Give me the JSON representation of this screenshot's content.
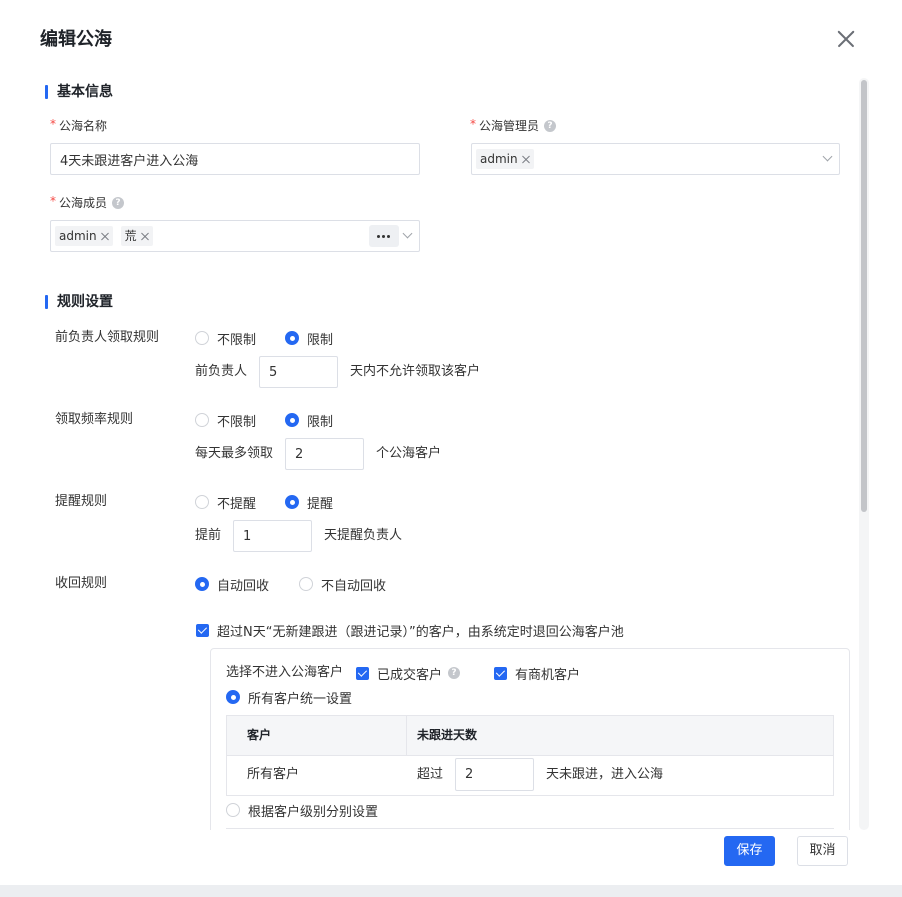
{
  "dialog": {
    "title": "编辑公海"
  },
  "basic": {
    "section_title": "基本信息",
    "required_mark": "*",
    "name": {
      "label": "公海名称",
      "value": "4天未跟进客户进入公海"
    },
    "admin": {
      "label": "公海管理员",
      "tags": [
        "admin"
      ]
    },
    "members": {
      "label": "公海成员",
      "tags": [
        "admin",
        "荒"
      ]
    }
  },
  "rules": {
    "section_title": "规则设置",
    "prev_owner": {
      "label": "前负责人领取规则",
      "options": [
        "不限制",
        "限制"
      ],
      "selected": 1,
      "prefix": "前负责人",
      "value": "5",
      "suffix": "天内不允许领取该客户"
    },
    "frequency": {
      "label": "领取频率规则",
      "options": [
        "不限制",
        "限制"
      ],
      "selected": 1,
      "prefix": "每天最多领取",
      "value": "2",
      "suffix": "个公海客户"
    },
    "remind": {
      "label": "提醒规则",
      "options": [
        "不提醒",
        "提醒"
      ],
      "selected": 1,
      "prefix": "提前",
      "value": "1",
      "suffix": "天提醒负责人"
    },
    "recycle": {
      "label": "收回规则",
      "options": [
        "自动回收",
        "不自动回收"
      ],
      "selected": 0
    },
    "auto_return": {
      "checked": true,
      "label": "超过N天“无新建跟进（跟进记录）”的客户，由系统定时退回公海客户池",
      "exclude_label": "选择不进入公海客户",
      "exclude_options": [
        {
          "label": "已成交客户",
          "checked": true
        },
        {
          "label": "有商机客户",
          "checked": true
        }
      ],
      "modes": [
        "所有客户统一设置",
        "根据客户级别分别设置"
      ],
      "mode_selected": 0,
      "table": {
        "headers": [
          "客户",
          "未跟进天数"
        ],
        "rows": [
          {
            "customer": "所有客户",
            "prefix": "超过",
            "value": "2",
            "suffix": "天未跟进，进入公海"
          }
        ]
      }
    }
  },
  "footer": {
    "save": "保存",
    "cancel": "取消"
  },
  "icons": [
    "close-icon",
    "help-icon",
    "chevron-down-icon",
    "tag-close-icon",
    "more-icon",
    "check-icon"
  ],
  "colors": {
    "primary": "#2468f2",
    "required": "#f54a45"
  }
}
